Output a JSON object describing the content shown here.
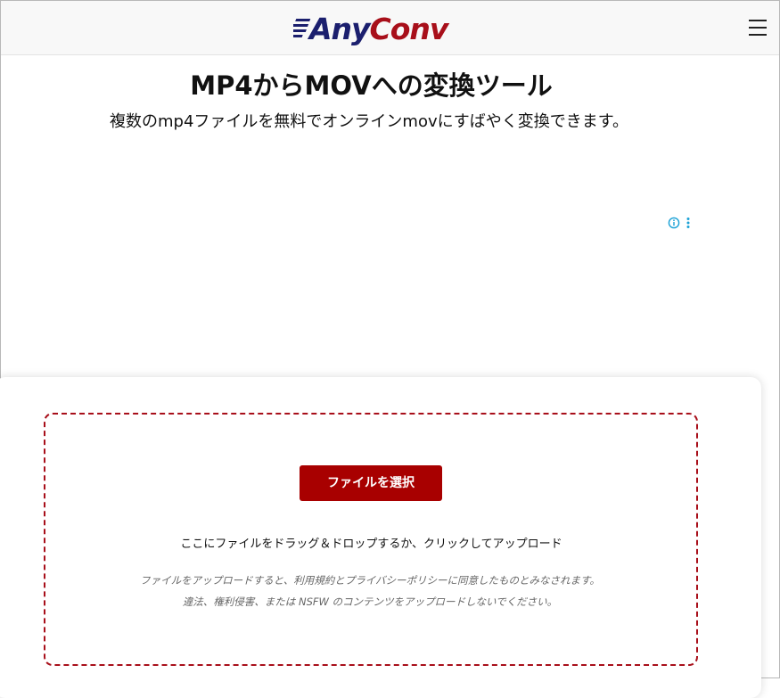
{
  "header": {
    "logo": {
      "part1": "Any",
      "part2": "Conv"
    },
    "menu_icon": "hamburger-menu-icon"
  },
  "main": {
    "title": "MP4からMOVへの変換ツール",
    "subtitle": "複数のmp4ファイルを無料でオンラインmovにすばやく変換できます。"
  },
  "ad": {
    "info_icon": "info-icon",
    "more_icon": "vertical-dots-icon"
  },
  "uploader": {
    "button_label": "ファイルを選択",
    "drop_hint": "ここにファイルをドラッグ＆ドロップするか、クリックしてアップロード",
    "legal_line1": "ファイルをアップロードすると、利用規約とプライバシーポリシーに同意したものとみなされます。",
    "legal_line2": "違法、権利侵害、または NSFW のコンテンツをアップロードしないでください。"
  },
  "colors": {
    "brand_red": "#a80000",
    "brand_navy": "#1b1f6e",
    "dashed_border": "#a80f1a",
    "ad_icon": "#1aa1d6"
  }
}
